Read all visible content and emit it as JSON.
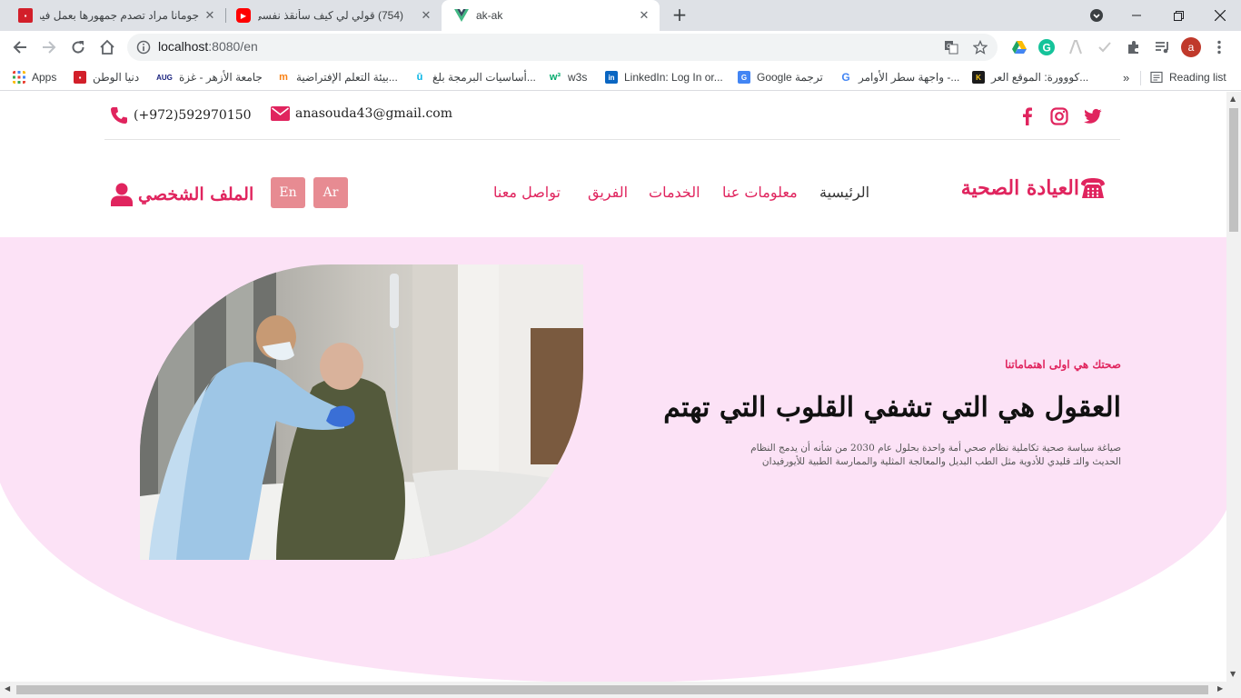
{
  "browser": {
    "tabs": [
      {
        "title": "جومانا مراد تصدم جمهورها بعمل فيديو",
        "favicon": "dunya-watan-icon"
      },
      {
        "title": "(754) قولي لي كيف سأنقذ نفسي",
        "favicon": "youtube-icon"
      },
      {
        "title": "ak-ak",
        "favicon": "vue-icon"
      }
    ],
    "new_tab": "+",
    "url_host": "localhost",
    "url_rest": ":8080/en",
    "profile_initial": "a",
    "bookmarks": [
      {
        "label": "Apps",
        "icon": "apps-grid-icon"
      },
      {
        "label": "دنيا الوطن",
        "icon": "dunya-watan-icon"
      },
      {
        "label": "جامعة الأزهر - غزة",
        "icon": "azhar-icon"
      },
      {
        "label": "بيئة التعلم الإفتراضية...",
        "icon": "moodle-icon"
      },
      {
        "label": "أساسيات البرمجة بلغ...",
        "icon": "udacity-icon"
      },
      {
        "label": "w3s",
        "icon": "w3schools-icon"
      },
      {
        "label": "LinkedIn: Log In or...",
        "icon": "linkedin-icon"
      },
      {
        "label": "Google ترجمة",
        "icon": "google-translate-icon"
      },
      {
        "label": "واجهة سطر الأوامر -...",
        "icon": "google-icon"
      },
      {
        "label": "كووورة: الموقع العر...",
        "icon": "kooora-icon"
      }
    ],
    "more_bookmarks": "»",
    "reading_list": "Reading list"
  },
  "site": {
    "phone": "(+972)592970150",
    "email": "anasouda43@gmail.com",
    "logo": "العيادة الصحية",
    "nav": [
      "الرئيسية",
      "معلومات عنا",
      "الخدمات",
      "الفريق",
      "تواصل معنا"
    ],
    "lang_en": "En",
    "lang_ar": "Ar",
    "profile": "الملف الشخصي",
    "accent": "#e0245e",
    "hero": {
      "tag": "صحتك هي اولى اهتماماتنا",
      "title": "العقول هي التي تشفي القلوب التي تهتم",
      "description": "صياغة سياسة صحية تكاملية نظام صحي أمة واحدة بحلول عام 2030 من شأنه أن يدمج النظام الحديث والتـ قليدي للأدوية مثل الطب البديل والمعالجة المثلية والممارسة الطبية للأيورفيدان"
    }
  }
}
